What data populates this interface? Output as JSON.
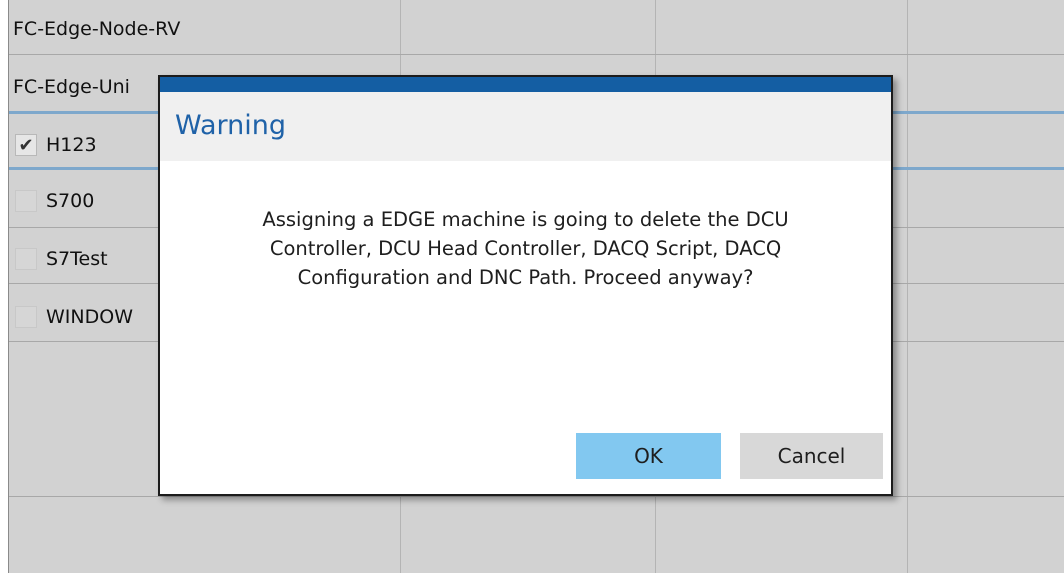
{
  "list": {
    "rows": [
      {
        "label": "FC-Edge-Node-RV",
        "checkbox": false
      },
      {
        "label": "FC-Edge-Uni",
        "checkbox": false
      },
      {
        "label": "H123",
        "checkbox": true,
        "checked": true
      },
      {
        "label": "S700",
        "checkbox": true,
        "checked": false
      },
      {
        "label": "S7Test",
        "checkbox": true,
        "checked": false
      },
      {
        "label": "WINDOW",
        "checkbox": true,
        "checked": false
      }
    ],
    "check_glyph": "✔"
  },
  "dialog": {
    "title": "Warning",
    "message_lines": [
      "Assigning a EDGE machine is going to delete the DCU",
      "Controller, DCU Head Controller, DACQ Script, DACQ",
      "Configuration and DNC Path. Proceed anyway?"
    ],
    "ok_label": "OK",
    "cancel_label": "Cancel"
  },
  "colors": {
    "dialog_title_bar": "#145ea3",
    "dialog_title_text": "#1f62a8",
    "ok_button": "#82c8f0",
    "cancel_button": "#d8d8d8",
    "selected_row_border": "#7ea8cc"
  }
}
